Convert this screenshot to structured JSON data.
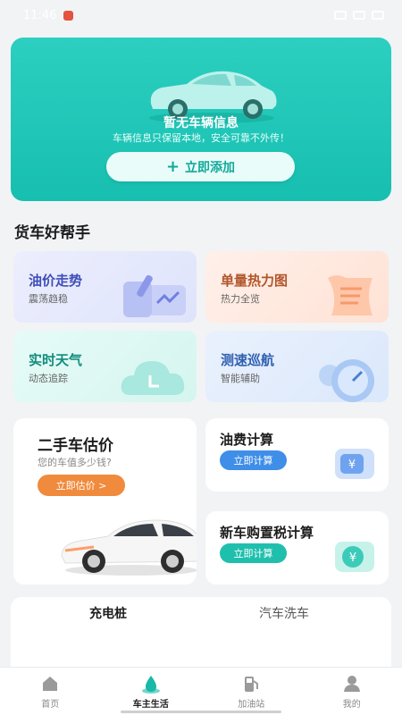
{
  "status_bar": {
    "time": "11:46"
  },
  "hero": {
    "title": "暂无车辆信息",
    "subtitle": "车辆信息只保留本地，安全可靠不外传！",
    "add_label": "立即添加",
    "accent": "#1fc3b3"
  },
  "helpers": {
    "title": "货车好帮手",
    "tiles": [
      {
        "title": "油价走势",
        "subtitle": "震荡趋稳"
      },
      {
        "title": "单量热力图",
        "subtitle": "热力全览"
      },
      {
        "title": "实时天气",
        "subtitle": "动态追踪"
      },
      {
        "title": "测速巡航",
        "subtitle": "智能辅助"
      }
    ]
  },
  "used_car": {
    "title": "二手车估价",
    "subtitle": "您的车值多少钱?",
    "button": "立即估价 >"
  },
  "fuel_cost": {
    "title": "油费计算",
    "button": "立即计算"
  },
  "purchase_tax": {
    "title": "新车购置税计算",
    "button": "立即计算"
  },
  "services": {
    "tabs": [
      "充电桩",
      "汽车洗车"
    ]
  },
  "tabbar": {
    "items": [
      {
        "label": "首页",
        "icon": "home-icon"
      },
      {
        "label": "车主生活",
        "icon": "drop-icon"
      },
      {
        "label": "加油站",
        "icon": "fuel-pump-icon"
      },
      {
        "label": "我的",
        "icon": "person-icon"
      }
    ],
    "active_index": 1,
    "active_color": "#17b9a8"
  }
}
